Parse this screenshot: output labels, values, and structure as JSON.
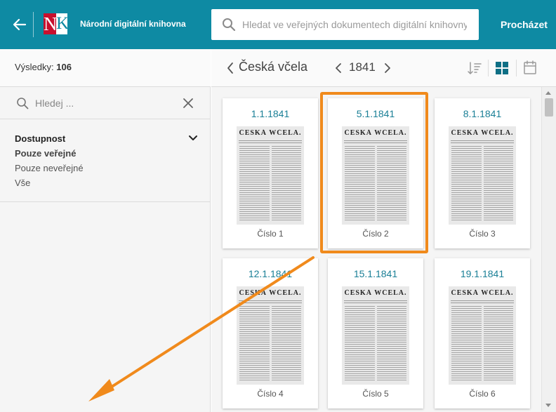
{
  "header": {
    "back_icon": "arrow-left-icon",
    "logo": {
      "left": "N",
      "right": "K"
    },
    "app_title": "Národní digitální knihovna",
    "search_placeholder": "Hledat ve veřejných dokumentech digitální knihovny",
    "browse_label": "Procházet",
    "bg_color": "#0e8aa3"
  },
  "sidebar": {
    "results_label": "Výsledky:",
    "results_count": "106",
    "search_placeholder": "Hledej ...",
    "filter": {
      "title": "Dostupnost",
      "options": [
        {
          "label": "Pouze veřejné",
          "selected": true
        },
        {
          "label": "Pouze neveřejné",
          "selected": false
        },
        {
          "label": "Vše",
          "selected": false
        }
      ]
    }
  },
  "toolbar": {
    "title": "Česká včela",
    "year": "1841",
    "view_mode": "grid",
    "icons": [
      "sort-icon",
      "grid-view-icon",
      "calendar-icon"
    ]
  },
  "cards": [
    {
      "date": "1.1.1841",
      "label": "Číslo 1",
      "masthead": "ČESKÁ WČELA."
    },
    {
      "date": "5.1.1841",
      "label": "Číslo 2",
      "masthead": "ČESKÁ WČELA.",
      "highlighted": true
    },
    {
      "date": "8.1.1841",
      "label": "Číslo 3",
      "masthead": "ČESKÁ WČELA."
    },
    {
      "date": "12.1.1841",
      "label": "Číslo 4",
      "masthead": "ČESKÁ WČELA."
    },
    {
      "date": "15.1.1841",
      "label": "Číslo 5",
      "masthead": "ČESKÁ WČELA."
    },
    {
      "date": "19.1.1841",
      "label": "Číslo 6",
      "masthead": "ČESKÁ WČELA."
    }
  ],
  "annotation": {
    "highlight_color": "#f08a1c"
  }
}
